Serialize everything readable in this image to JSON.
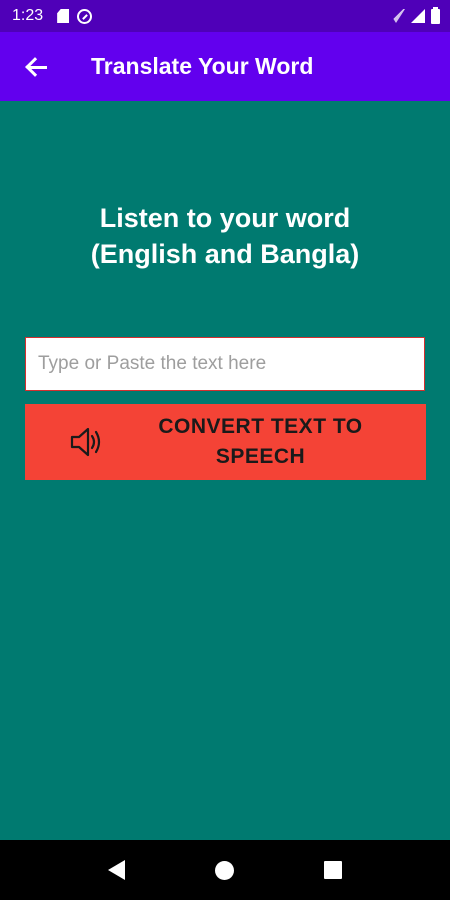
{
  "status_bar": {
    "time": "1:23",
    "icons": [
      "sd-card-icon",
      "sync-icon",
      "wifi-icon",
      "signal-icon",
      "battery-icon"
    ]
  },
  "app_bar": {
    "title": "Translate Your Word",
    "back_icon": "arrow-back-icon",
    "background": "#6200ee"
  },
  "main": {
    "heading_line1": "Listen to your word",
    "heading_line2": "(English and Bangla)",
    "input": {
      "value": "",
      "placeholder": "Type or Paste the text here"
    },
    "convert_button": {
      "label_line1": "CONVERT TEXT TO",
      "label_line2": "SPEECH",
      "icon": "speaker-icon",
      "color": "#f44336"
    },
    "background": "#007a70"
  },
  "nav_bar": {
    "icons": [
      "nav-back-icon",
      "nav-home-icon",
      "nav-recents-icon"
    ]
  }
}
